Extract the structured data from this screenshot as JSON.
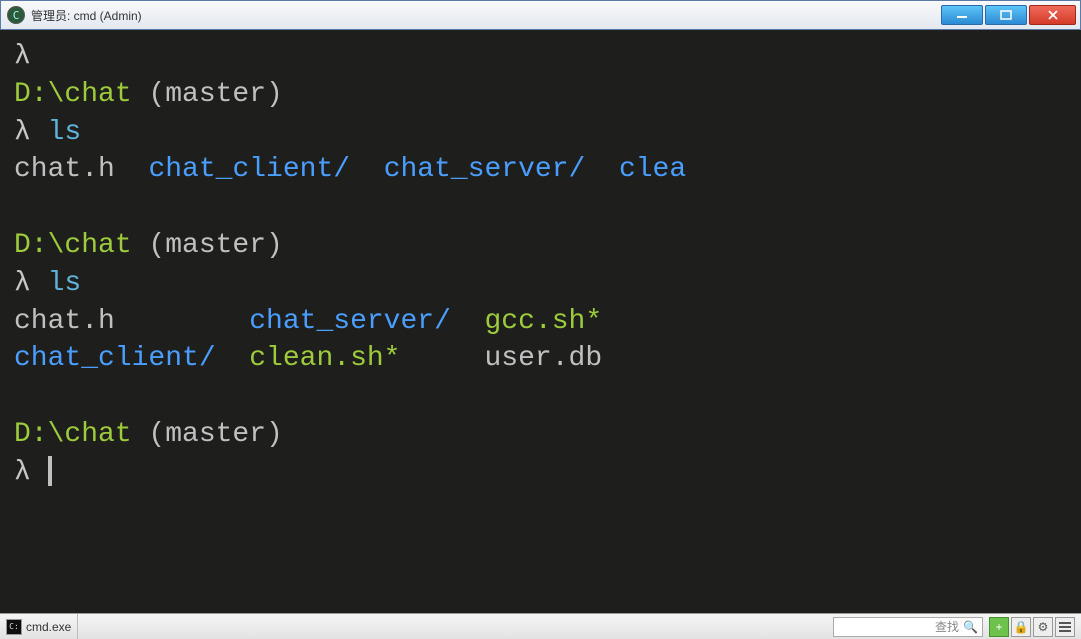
{
  "window": {
    "title": "管理员: cmd (Admin)"
  },
  "terminal": {
    "blocks": [
      {
        "prompt_prefix": "λ",
        "path": "D:\\chat",
        "branch": "(master)",
        "command": "ls",
        "output": [
          [
            {
              "text": "chat.h",
              "cls": "file-plain"
            },
            {
              "text": "  ",
              "cls": ""
            },
            {
              "text": "chat_client/",
              "cls": "file-dir"
            },
            {
              "text": "  ",
              "cls": ""
            },
            {
              "text": "chat_server/",
              "cls": "file-dir"
            },
            {
              "text": "  ",
              "cls": ""
            },
            {
              "text": "clea",
              "cls": "file-other"
            }
          ]
        ]
      },
      {
        "prompt_prefix": "λ",
        "path": "D:\\chat",
        "branch": "(master)",
        "command": "ls",
        "output": [
          [
            {
              "text": "chat.h",
              "cls": "file-plain"
            },
            {
              "text": "        ",
              "cls": ""
            },
            {
              "text": "chat_server/",
              "cls": "file-dir"
            },
            {
              "text": "  ",
              "cls": ""
            },
            {
              "text": "gcc.sh*",
              "cls": "file-exec"
            }
          ],
          [
            {
              "text": "chat_client/",
              "cls": "file-dir"
            },
            {
              "text": "  ",
              "cls": ""
            },
            {
              "text": "clean.sh*",
              "cls": "file-exec"
            },
            {
              "text": "     ",
              "cls": ""
            },
            {
              "text": "user.db",
              "cls": "file-plain"
            }
          ]
        ]
      }
    ],
    "current_prompt": {
      "prompt_prefix": "λ",
      "path": "D:\\chat",
      "branch": "(master)"
    }
  },
  "statusbar": {
    "tab_label": "cmd.exe",
    "search_placeholder": "查找",
    "plus_label": "+"
  }
}
